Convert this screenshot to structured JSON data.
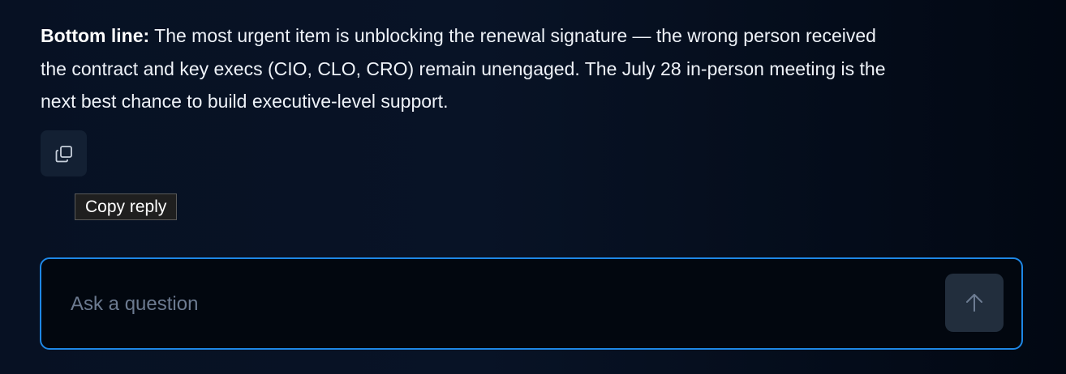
{
  "reply": {
    "label": "Bottom line:",
    "lines": [
      "The most urgent item is unblocking the renewal signature — the wrong person received",
      "the contract and key execs (CIO, CLO, CRO) remain unengaged. The July 28 in-person meeting is the",
      "next best chance to build executive-level support."
    ]
  },
  "copy": {
    "icon": "copy-icon",
    "tooltip": "Copy reply"
  },
  "composer": {
    "placeholder": "Ask a question",
    "value": "",
    "send_icon": "arrow-up-icon"
  },
  "colors": {
    "accent": "#1e87e5",
    "background": "#071123",
    "send_button": "#222e3d"
  }
}
